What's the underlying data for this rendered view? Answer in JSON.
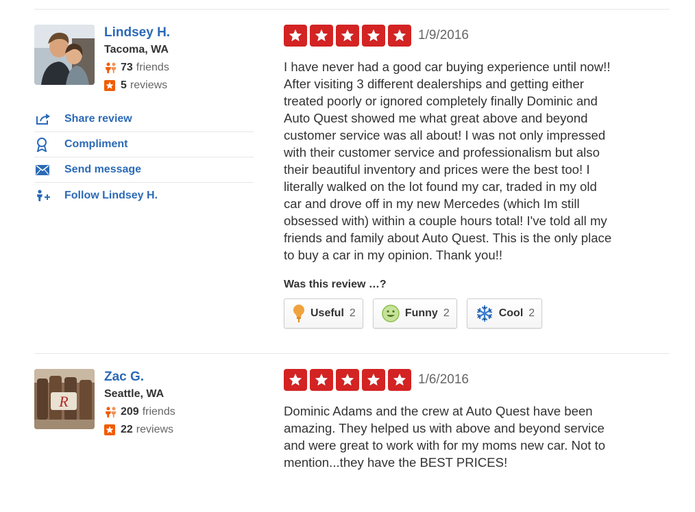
{
  "reviews": [
    {
      "user": {
        "name": "Lindsey H.",
        "location": "Tacoma, WA",
        "friends_count": "73",
        "friends_label": "friends",
        "reviews_count": "5",
        "reviews_label": "reviews"
      },
      "actions": {
        "share": "Share review",
        "compliment": "Compliment",
        "message": "Send message",
        "follow": "Follow Lindsey H."
      },
      "rating": 5,
      "date": "1/9/2016",
      "text": "I have never had a good car buying experience until now!!\nAfter visiting 3 different dealerships and getting either\ntreated poorly or ignored completely finally Dominic and\nAuto Quest showed me what great above and beyond\ncustomer service was all about! I was not only impressed\nwith their customer service and professionalism but also\ntheir beautiful inventory and prices were the best too! I\nliterally walked on the lot found my car, traded in my old\ncar and drove off in my new Mercedes (which Im still\nobsessed with) within a couple hours total! I've told all my\nfriends and family about Auto Quest. This is the only place\nto buy a car in my opinion. Thank you!!",
      "vote_question": "Was this review …?",
      "votes": {
        "useful_label": "Useful",
        "useful_count": "2",
        "funny_label": "Funny",
        "funny_count": "2",
        "cool_label": "Cool",
        "cool_count": "2"
      }
    },
    {
      "user": {
        "name": "Zac G.",
        "location": "Seattle, WA",
        "friends_count": "209",
        "friends_label": "friends",
        "reviews_count": "22",
        "reviews_label": "reviews"
      },
      "rating": 5,
      "date": "1/6/2016",
      "text": "Dominic Adams and the crew at Auto Quest have been\namazing.  They helped us with above and beyond service\nand were great to work with for my moms new car.  Not to\nmention...they have the BEST PRICES!"
    }
  ],
  "colors": {
    "accent_red": "#d32323",
    "link_blue": "#2b6ab6",
    "friends_orange": "#f15c00"
  },
  "icons": {
    "share": "share-arrow-icon",
    "compliment": "ribbon-icon",
    "message": "envelope-icon",
    "follow": "follow-user-icon",
    "useful": "lightbulb-icon",
    "funny": "smiley-icon",
    "cool": "snowflake-icon",
    "friends": "friends-icon",
    "reviews": "review-star-icon"
  }
}
